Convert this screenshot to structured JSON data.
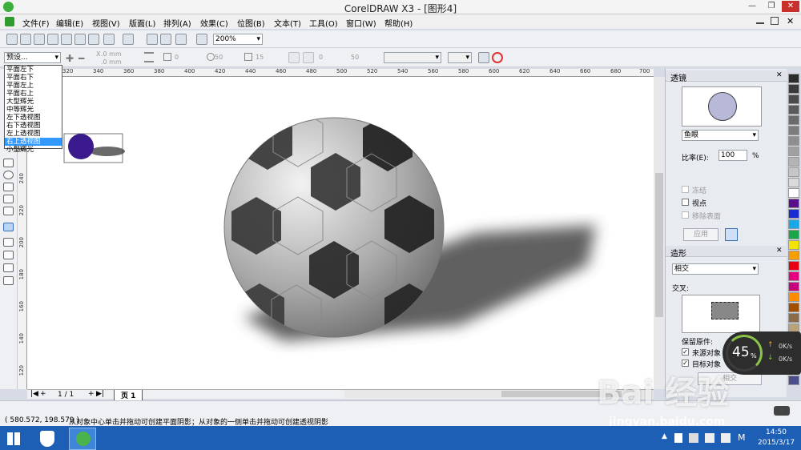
{
  "window": {
    "title": "CorelDRAW X3 - [图形4]",
    "minimize": "—",
    "restore": "❐",
    "close": "✕",
    "help": "?"
  },
  "menu": [
    "文件(F)",
    "编辑(E)",
    "视图(V)",
    "版面(L)",
    "排列(A)",
    "效果(C)",
    "位图(B)",
    "文本(T)",
    "工具(O)",
    "窗口(W)",
    "帮助(H)"
  ],
  "toolbar": {
    "zoom": "200%"
  },
  "propbar": {
    "preset": "预设...",
    "x_label": "X",
    "x": ".0 mm",
    "y": ".0 mm",
    "angle": "0",
    "opacity": "50",
    "feather": "15",
    "offset": "0",
    "fade": "50"
  },
  "presets": {
    "items": [
      "平面左下",
      "平面右下",
      "平面左上",
      "平面右上",
      "大型辉光",
      "中等辉光",
      "左下透视图",
      "右下透视图",
      "左上透视图",
      "右上透视图",
      "小型辉光"
    ],
    "selected": 9
  },
  "ruler": {
    "top": [
      "300",
      "320",
      "340",
      "360",
      "380",
      "400",
      "420",
      "440",
      "460",
      "480",
      "500",
      "520",
      "540",
      "560",
      "580",
      "600",
      "620",
      "640",
      "660",
      "680",
      "700"
    ],
    "left": [
      "260",
      "240",
      "220",
      "200",
      "180",
      "160",
      "140",
      "120"
    ]
  },
  "pagenav": {
    "counter": "1 / 1",
    "page": "页 1"
  },
  "lens": {
    "title": "透镜",
    "type": "鱼眼",
    "ratio_label": "比率(E):",
    "ratio": "100",
    "ratio_unit": "%",
    "frozen": "冻结",
    "viewpoint": "视点",
    "remove_face": "移除表面",
    "apply": "应用"
  },
  "shaping": {
    "title": "造形",
    "mode": "相交",
    "intersect_label": "交叉:",
    "keep_label": "保留原件:",
    "source": "来源对象",
    "target": "目标对象",
    "button": "相交"
  },
  "palette": [
    "#2b2b2b",
    "#3a3a3a",
    "#4a4a4a",
    "#5a5a5a",
    "#6b6b6b",
    "#7c7c7c",
    "#8e8e8e",
    "#a0a0a0",
    "#b3b3b3",
    "#c6c6c6",
    "#dadada",
    "#ffffff",
    "#5b0e8c",
    "#1a2bd1",
    "#18a8e8",
    "#19a54a",
    "#f2e400",
    "#f5a000",
    "#e60012",
    "#e4007f",
    "#c7007d",
    "#ff8c00",
    "#a05000",
    "#8c6b4a",
    "#b8a27a",
    "#c2a6d4",
    "#9b7fc6",
    "#7a6bb8",
    "#5d5aa6",
    "#4a4e8a"
  ],
  "status": {
    "coords": "( 580.572, 198.579 )",
    "hint": "从对象中心单击并拖动可创建平面阴影；从对象的一侧单击并拖动可创建透视阴影"
  },
  "perf": {
    "percent": "45",
    "unit": "%",
    "up": "0K/s",
    "down": "0K/s"
  },
  "taskbar": {
    "time": "14:50",
    "date": "2015/3/17",
    "ime": "M"
  },
  "watermark": {
    "brand": "Bai 经验",
    "url": "jingyan.baidu.com"
  }
}
